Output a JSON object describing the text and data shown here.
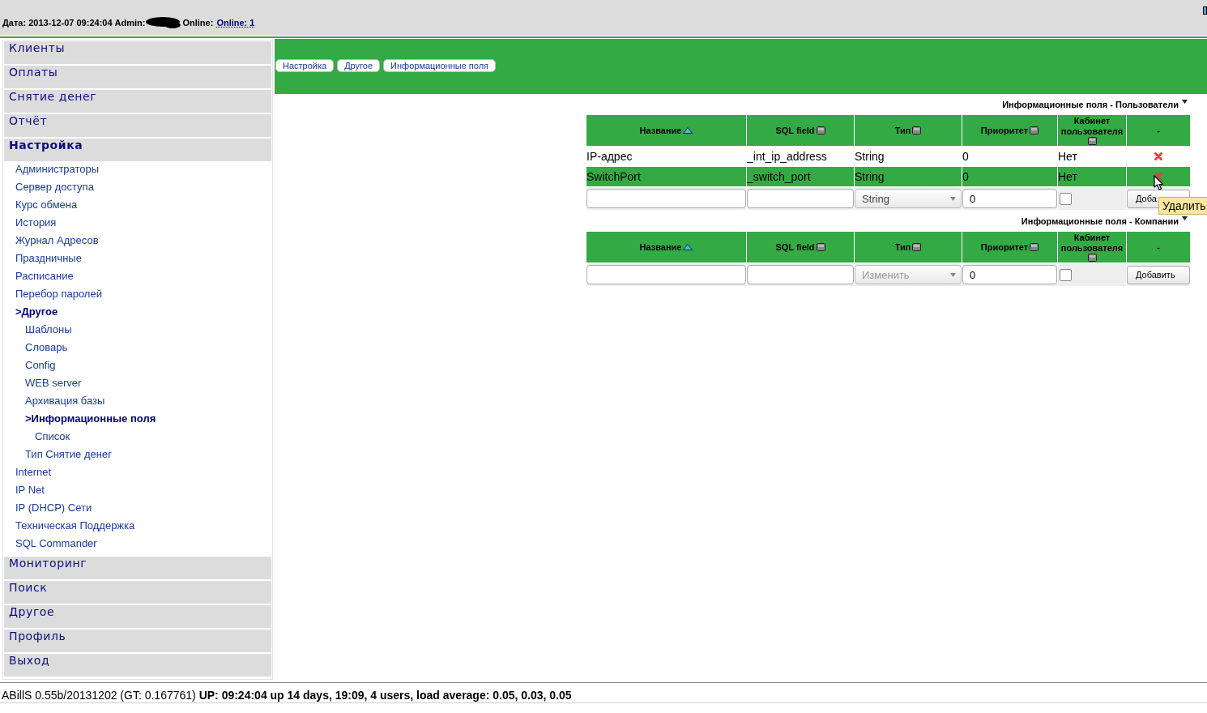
{
  "header": {
    "info": "Дата: 2013-12-07 09:24:04 Admin:",
    "online_label": "Online:",
    "online_link": "Online: 1"
  },
  "menu": [
    {
      "label": "Клиенты",
      "selected": false
    },
    {
      "label": "Оплаты",
      "selected": false
    },
    {
      "label": "Снятие денег",
      "selected": false
    },
    {
      "label": "Отчёт",
      "selected": false
    },
    {
      "label": "Настройка",
      "selected": true,
      "children": [
        {
          "label": "Администраторы",
          "selected": false
        },
        {
          "label": "Сервер доступа",
          "selected": false
        },
        {
          "label": "Курс обмена",
          "selected": false
        },
        {
          "label": "История",
          "selected": false
        },
        {
          "label": "Журнал Адресов",
          "selected": false
        },
        {
          "label": "Праздничные",
          "selected": false
        },
        {
          "label": "Расписание",
          "selected": false
        },
        {
          "label": "Перебор паролей",
          "selected": false
        },
        {
          "label": ">Другое",
          "selected": true,
          "children": [
            {
              "label": "Шаблоны",
              "selected": false
            },
            {
              "label": "Словарь",
              "selected": false
            },
            {
              "label": "Config",
              "selected": false
            },
            {
              "label": "WEB server",
              "selected": false
            },
            {
              "label": "Архивация базы",
              "selected": false
            },
            {
              "label": ">Информационные поля",
              "selected": true,
              "children": [
                {
                  "label": "Список",
                  "selected": false
                }
              ]
            },
            {
              "label": "Тип Снятие денег",
              "selected": false
            }
          ]
        },
        {
          "label": "Internet",
          "selected": false
        },
        {
          "label": "IP Net",
          "selected": false
        },
        {
          "label": "IP (DHCP) Сети",
          "selected": false
        },
        {
          "label": "Техническая Поддержка",
          "selected": false
        },
        {
          "label": "SQL Commander",
          "selected": false
        }
      ]
    },
    {
      "label": "Мониторинг",
      "selected": false
    },
    {
      "label": "Поиск",
      "selected": false
    },
    {
      "label": "Другое",
      "selected": false
    },
    {
      "label": "Профиль",
      "selected": false
    },
    {
      "label": "Выход",
      "selected": false
    }
  ],
  "breadcrumbs": [
    "Настройка",
    "Другое",
    "Информационные поля"
  ],
  "tables": [
    {
      "title": "Информационные поля - Пользователи",
      "columns": [
        {
          "label": "Название",
          "kind": "sorted"
        },
        {
          "label": "SQL field",
          "kind": "sortable"
        },
        {
          "label": "Тип",
          "kind": "sortable"
        },
        {
          "label": "Приоритет",
          "kind": "sortable"
        },
        {
          "label": "Кабинет пользователя",
          "kind": "stacked"
        },
        {
          "label": "-",
          "kind": "plain"
        }
      ],
      "rows": [
        {
          "cells": [
            "IP-адрес",
            "_int_ip_address",
            "String",
            "0",
            "Нет"
          ],
          "highlighted": false
        },
        {
          "cells": [
            "SwitchPort",
            "_switch_port",
            "String",
            "0",
            "Нет"
          ],
          "highlighted": true
        }
      ],
      "new_row": {
        "type_value": "String",
        "type_disabled": false,
        "priority": "0",
        "checked": false,
        "button": "Доба"
      }
    },
    {
      "title": "Информационные поля - Компании",
      "columns": [
        {
          "label": "Название",
          "kind": "sorted"
        },
        {
          "label": "SQL field",
          "kind": "sortable"
        },
        {
          "label": "Тип",
          "kind": "sortable"
        },
        {
          "label": "Приоритет",
          "kind": "sortable"
        },
        {
          "label": "Кабинет пользователя",
          "kind": "stacked"
        },
        {
          "label": "-",
          "kind": "plain"
        }
      ],
      "new_row": {
        "type_value": "Изменить",
        "type_disabled": true,
        "priority": "0",
        "checked": false,
        "button": "Добавить"
      }
    }
  ],
  "tooltip": "Удалить",
  "footer": {
    "version": "ABillS 0.55b/20131202 (GT: 0.167761)",
    "uptime": "UP: 09:24:04 up 14 days, 19:09, 4 users, load average: 0.05, 0.03, 0.05"
  }
}
